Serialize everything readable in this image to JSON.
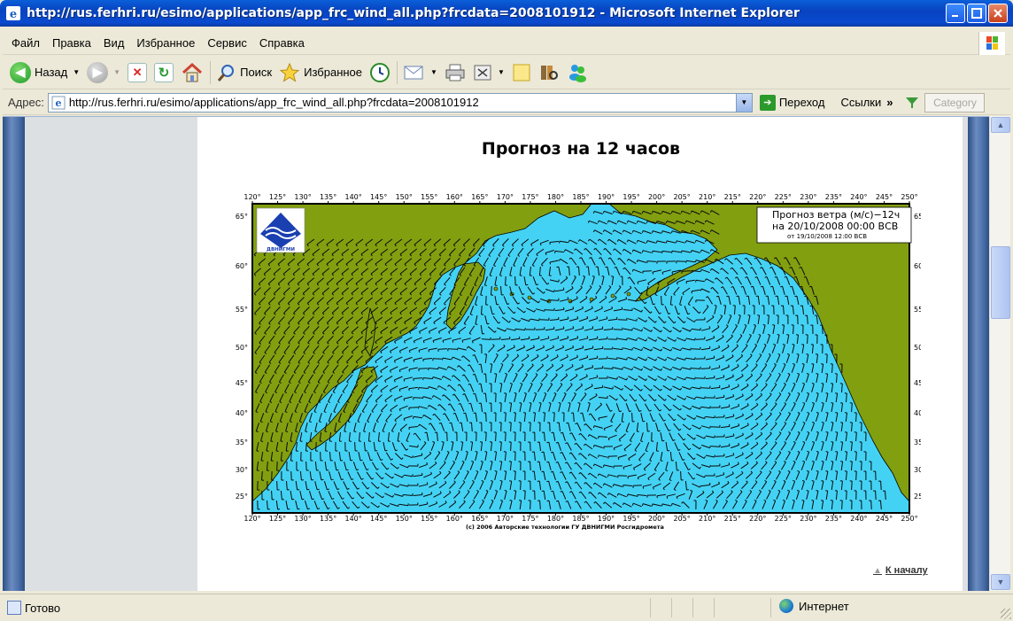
{
  "window": {
    "title": "http://rus.ferhri.ru/esimo/applications/app_frc_wind_all.php?frcdata=2008101912 - Microsoft Internet Explorer"
  },
  "menu": [
    "Файл",
    "Правка",
    "Вид",
    "Избранное",
    "Сервис",
    "Справка"
  ],
  "toolbar": {
    "back_label": "Назад",
    "search_label": "Поиск",
    "favorites_label": "Избранное"
  },
  "address": {
    "label": "Адрес:",
    "url": "http://rus.ferhri.ru/esimo/applications/app_frc_wind_all.php?frcdata=2008101912",
    "go_label": "Переход",
    "links_label": "Ссылки",
    "category_placeholder": "Category"
  },
  "page": {
    "heading": "Прогноз на 12 часов",
    "back_to_top": "К началу"
  },
  "map": {
    "legend_line1": "Прогноз ветра (м/с)−12ч",
    "legend_line2": "на 20/10/2008 00:00 ВСВ",
    "legend_line3": "от 19/10/2008 12:00 ВСВ",
    "logo_text": "ДВНИГМИ",
    "copyright": "(c) 2006 Авторские технологии ГУ ДВНИГМИ Росгидромета",
    "lon_labels": [
      "120°",
      "125°",
      "130°",
      "135°",
      "140°",
      "145°",
      "150°",
      "155°",
      "160°",
      "165°",
      "170°",
      "175°",
      "180°",
      "185°",
      "190°",
      "195°",
      "200°",
      "205°",
      "210°",
      "215°",
      "220°",
      "225°",
      "230°",
      "235°",
      "240°",
      "245°",
      "250°"
    ],
    "lat_labels": [
      "65°",
      "60°",
      "55°",
      "50°",
      "45°",
      "40°",
      "35°",
      "30°",
      "25°"
    ],
    "colors": {
      "ocean": "#44d2f4",
      "land": "#829f10",
      "wind": "#0a0a0a"
    }
  },
  "status": {
    "text": "Готово",
    "zone": "Интернет"
  }
}
